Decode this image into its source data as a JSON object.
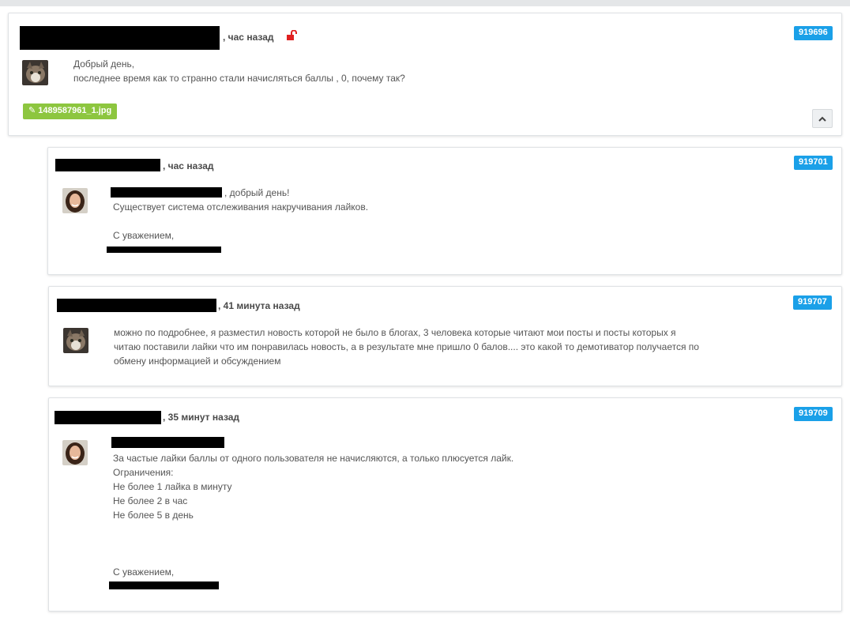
{
  "posts": [
    {
      "time": ", час назад",
      "id_badge": "919696",
      "avatar": "cat-avatar",
      "lines": [
        "Добрый день,",
        "последнее время как то странно стали начисляться баллы , 0, почему так?"
      ],
      "attachment": "1489587961_1.jpg",
      "icons": [
        "unlock-icon",
        "paperclip-icon",
        "chevron-up-icon"
      ]
    },
    {
      "time": ", час назад",
      "id_badge": "919701",
      "avatar": "woman-avatar",
      "greeting_suffix": ", добрый день!",
      "lines": [
        "Существует система отслеживания накручивания лайков.",
        "",
        "С уважением,"
      ]
    },
    {
      "time": ", 41 минута назад",
      "id_badge": "919707",
      "avatar": "cat-avatar",
      "lines": [
        "можно по подробнее, я разместил новость которой не было в блогах, 3 человека которые читают мои посты и посты которых я",
        "читаю поставили лайки что им понравилась новость, а в результате мне пришло 0 балов.... это какой то демотиватор получается по",
        "обмену информацией и обсуждением"
      ]
    },
    {
      "time": ", 35 минут назад",
      "id_badge": "919709",
      "avatar": "woman-avatar",
      "lines": [
        "За частые лайки баллы от одного пользователя не начисляются, а только плюсуется лайк.",
        "Ограничения:",
        "Не более 1 лайка в минуту",
        "Не более 2 в час",
        "Не более 5 в день",
        "",
        "",
        "",
        "С уважением,"
      ]
    }
  ],
  "colors": {
    "badge": "#1aa0e8",
    "attachment": "#8dc63f",
    "unlock": "#e02020"
  }
}
